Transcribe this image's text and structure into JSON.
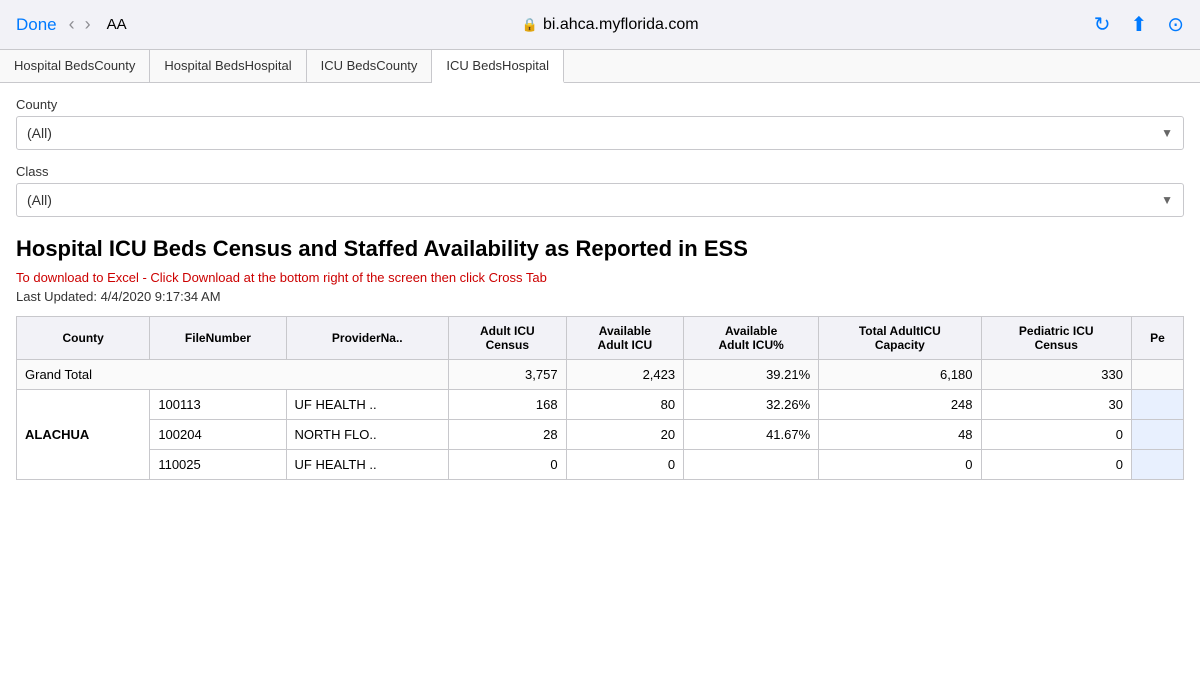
{
  "browser": {
    "done_label": "Done",
    "nav_back": "‹",
    "nav_forward": "›",
    "aa_label": "AA",
    "url": "bi.ahca.myflorida.com",
    "lock_icon": "🔒"
  },
  "tabs": [
    {
      "id": "hospital-beds-county",
      "label": "Hospital BedsCounty",
      "active": false
    },
    {
      "id": "hospital-beds-hospital",
      "label": "Hospital BedsHospital",
      "active": false
    },
    {
      "id": "icu-beds-county",
      "label": "ICU BedsCounty",
      "active": false
    },
    {
      "id": "icu-beds-hospital",
      "label": "ICU BedsHospital",
      "active": true
    }
  ],
  "filters": {
    "county": {
      "label": "County",
      "value": "(All)"
    },
    "class": {
      "label": "Class",
      "value": "(All)"
    }
  },
  "report": {
    "title": "Hospital ICU Beds Census and Staffed Availability as Reported in ESS",
    "download_note": "To download to Excel - Click Download at the bottom right of the screen then click Cross Tab",
    "last_updated_label": "Last Updated:",
    "last_updated_value": "4/4/2020 9:17:34 AM"
  },
  "table": {
    "headers": [
      "County",
      "FileNumber",
      "ProviderNa..",
      "Adult ICU Census",
      "Available Adult ICU",
      "Available Adult ICU%",
      "Total AdultICU Capacity",
      "Pediatric ICU Census",
      "Pe"
    ],
    "grand_total": {
      "county": "Grand Total",
      "file_number": "",
      "provider_name": "",
      "adult_icu_census": "3,757",
      "available_adult_icu": "2,423",
      "available_adult_icu_pct": "39.21%",
      "total_adult_icu_capacity": "6,180",
      "pediatric_icu_census": "330",
      "pe": ""
    },
    "rows": [
      {
        "county": "ALACHUA",
        "entries": [
          {
            "file_number": "100113",
            "provider_name": "UF HEALTH ..",
            "adult_icu_census": "168",
            "available_adult_icu": "80",
            "available_adult_icu_pct": "32.26%",
            "total_adult_icu_capacity": "248",
            "pediatric_icu_census": "30",
            "pe": ""
          },
          {
            "file_number": "100204",
            "provider_name": "NORTH FLO..",
            "adult_icu_census": "28",
            "available_adult_icu": "20",
            "available_adult_icu_pct": "41.67%",
            "total_adult_icu_capacity": "48",
            "pediatric_icu_census": "0",
            "pe": ""
          },
          {
            "file_number": "110025",
            "provider_name": "UF HEALTH ..",
            "adult_icu_census": "0",
            "available_adult_icu": "0",
            "available_adult_icu_pct": "",
            "total_adult_icu_capacity": "0",
            "pediatric_icu_census": "0",
            "pe": ""
          }
        ]
      }
    ]
  }
}
